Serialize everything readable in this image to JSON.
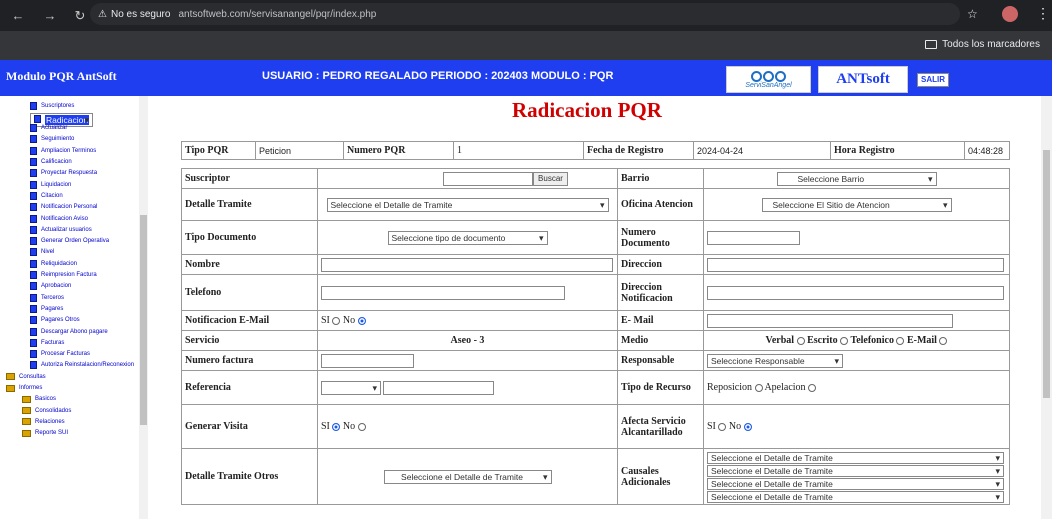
{
  "browser": {
    "security": "No es seguro",
    "url": "antsoftweb.com/servisanangel/pqr/index.php",
    "bookmarks": "Todos los marcadores"
  },
  "header": {
    "module_title": "Modulo PQR AntSoft",
    "user_info": "USUARIO : PEDRO REGALADO PERIODO : 202403 MODULO : PQR",
    "logo1": "ServiSanAngel",
    "logo2": "ANTsoft",
    "salir": "SALIR"
  },
  "sidebar": {
    "items": [
      "Suscriptores",
      "Radicacion",
      "Actualizar",
      "Seguimiento",
      "Ampliacion Terminos",
      "Calificacion",
      "Proyectar Respuesta",
      "Liquidacion",
      "Citacion",
      "Notificacion Personal",
      "Notificacion Aviso",
      "Actualizar usuarios",
      "Generar Orden Operativa",
      "Nivel",
      "Reliquidacion",
      "Reimpresion Factura",
      "Aprobacion",
      "Terceros",
      "Pagares",
      "Pagares Otros",
      "Descargar Abono pagare",
      "Facturas",
      "Procesar Facturas",
      "Autoriza Reinstalacion/Reconexion"
    ],
    "folders": [
      "Consultas",
      "Informes",
      "Basicos",
      "Consolidados",
      "Relaciones",
      "Reporte SUI"
    ]
  },
  "main": {
    "title": "Radicacion PQR",
    "top": {
      "tipo_pqr_label": "Tipo PQR",
      "tipo_pqr_value": "Peticion",
      "numero_label": "Numero PQR",
      "numero_value": "1",
      "fecha_label": "Fecha de Registro",
      "fecha_value": "2024-04-24",
      "hora_label": "Hora Registro",
      "hora_value": "04:48:28"
    },
    "form": {
      "suscriptor": "Suscriptor",
      "buscar": "Buscar",
      "barrio": "Barrio",
      "barrio_sel": "Seleccione Barrio",
      "detalle_tramite": "Detalle Tramite",
      "detalle_sel": "Seleccione el Detalle de Tramite",
      "oficina": "Oficina Atencion",
      "oficina_sel": "Seleccione El Sitio de Atencion",
      "tipo_doc": "Tipo Documento",
      "tipo_doc_sel": "Seleccione tipo de documento",
      "numero_doc": "Numero Documento",
      "nombre": "Nombre",
      "direccion": "Direccion",
      "telefono": "Telefono",
      "direccion_notif": "Direccion Notificacion",
      "notif_email": "Notificacion E-Mail",
      "si": "SI",
      "no": "No",
      "email": "E- Mail",
      "servicio": "Servicio",
      "servicio_val": "Aseo - 3",
      "medio": "Medio",
      "verbal": "Verbal",
      "escrito": "Escrito",
      "telefonico": "Telefonico",
      "emailr": "E-Mail",
      "numero_factura": "Numero factura",
      "responsable": "Responsable",
      "responsable_sel": "Seleccione Responsable",
      "referencia": "Referencia",
      "tipo_recurso": "Tipo de Recurso",
      "reposicion": "Reposicion",
      "apelacion": "Apelacion",
      "generar_visita": "Generar Visita",
      "afecta": "Afecta Servicio Alcantarillado",
      "detalle_otros": "Detalle Tramite Otros",
      "detalle_otros_sel": "Seleccione el Detalle de Tramite",
      "causales": "Causales Adicionales",
      "causal_sel": [
        "Seleccione el Detalle de Tramite",
        "Seleccione el Detalle de Tramite",
        "Seleccione el Detalle de Tramite",
        "Seleccione el Detalle de Tramite"
      ]
    }
  }
}
